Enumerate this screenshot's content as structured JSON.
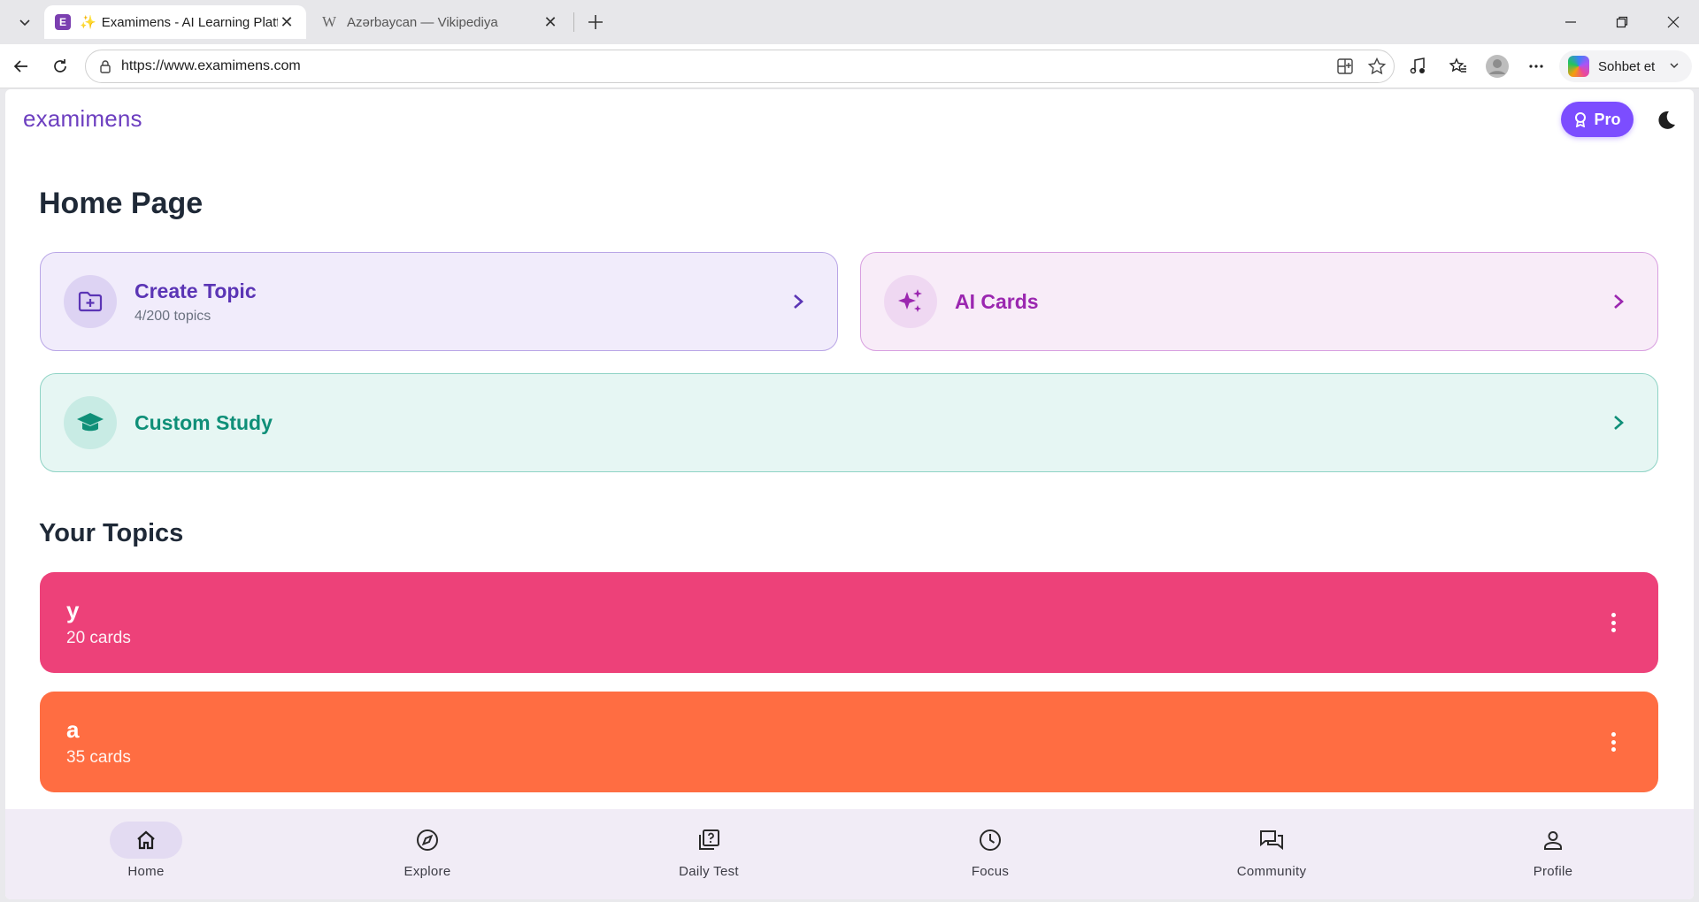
{
  "browser": {
    "tabs": [
      {
        "title": "Examimens - AI Learning Platform",
        "active": true
      },
      {
        "title": "Azərbaycan — Vikipediya",
        "active": false
      }
    ],
    "url": "https://www.examimens.com",
    "copilot_label": "Sohbet et"
  },
  "app": {
    "brand": "examimens",
    "pro_label": "Pro",
    "page_title": "Home Page",
    "actions": {
      "create_topic": {
        "label": "Create Topic",
        "sub": "4/200 topics"
      },
      "ai_cards": {
        "label": "AI Cards"
      },
      "custom_study": {
        "label": "Custom Study"
      }
    },
    "topics_title": "Your Topics",
    "topics": [
      {
        "name": "y",
        "count": "20 cards",
        "color": "#ed4179"
      },
      {
        "name": "a",
        "count": "35 cards",
        "color": "#ff6d42"
      }
    ],
    "nav": [
      {
        "label": "Home",
        "icon": "home-icon",
        "active": true
      },
      {
        "label": "Explore",
        "icon": "compass-icon",
        "active": false
      },
      {
        "label": "Daily Test",
        "icon": "quiz-icon",
        "active": false
      },
      {
        "label": "Focus",
        "icon": "clock-icon",
        "active": false
      },
      {
        "label": "Community",
        "icon": "chat-icon",
        "active": false
      },
      {
        "label": "Profile",
        "icon": "person-icon",
        "active": false
      }
    ]
  },
  "colors": {
    "brand": "#6d3fc0",
    "pro": "#7c4dff",
    "create_topic": "#5b35b5",
    "ai_cards": "#9b27b0",
    "custom_study": "#0f8f78"
  }
}
